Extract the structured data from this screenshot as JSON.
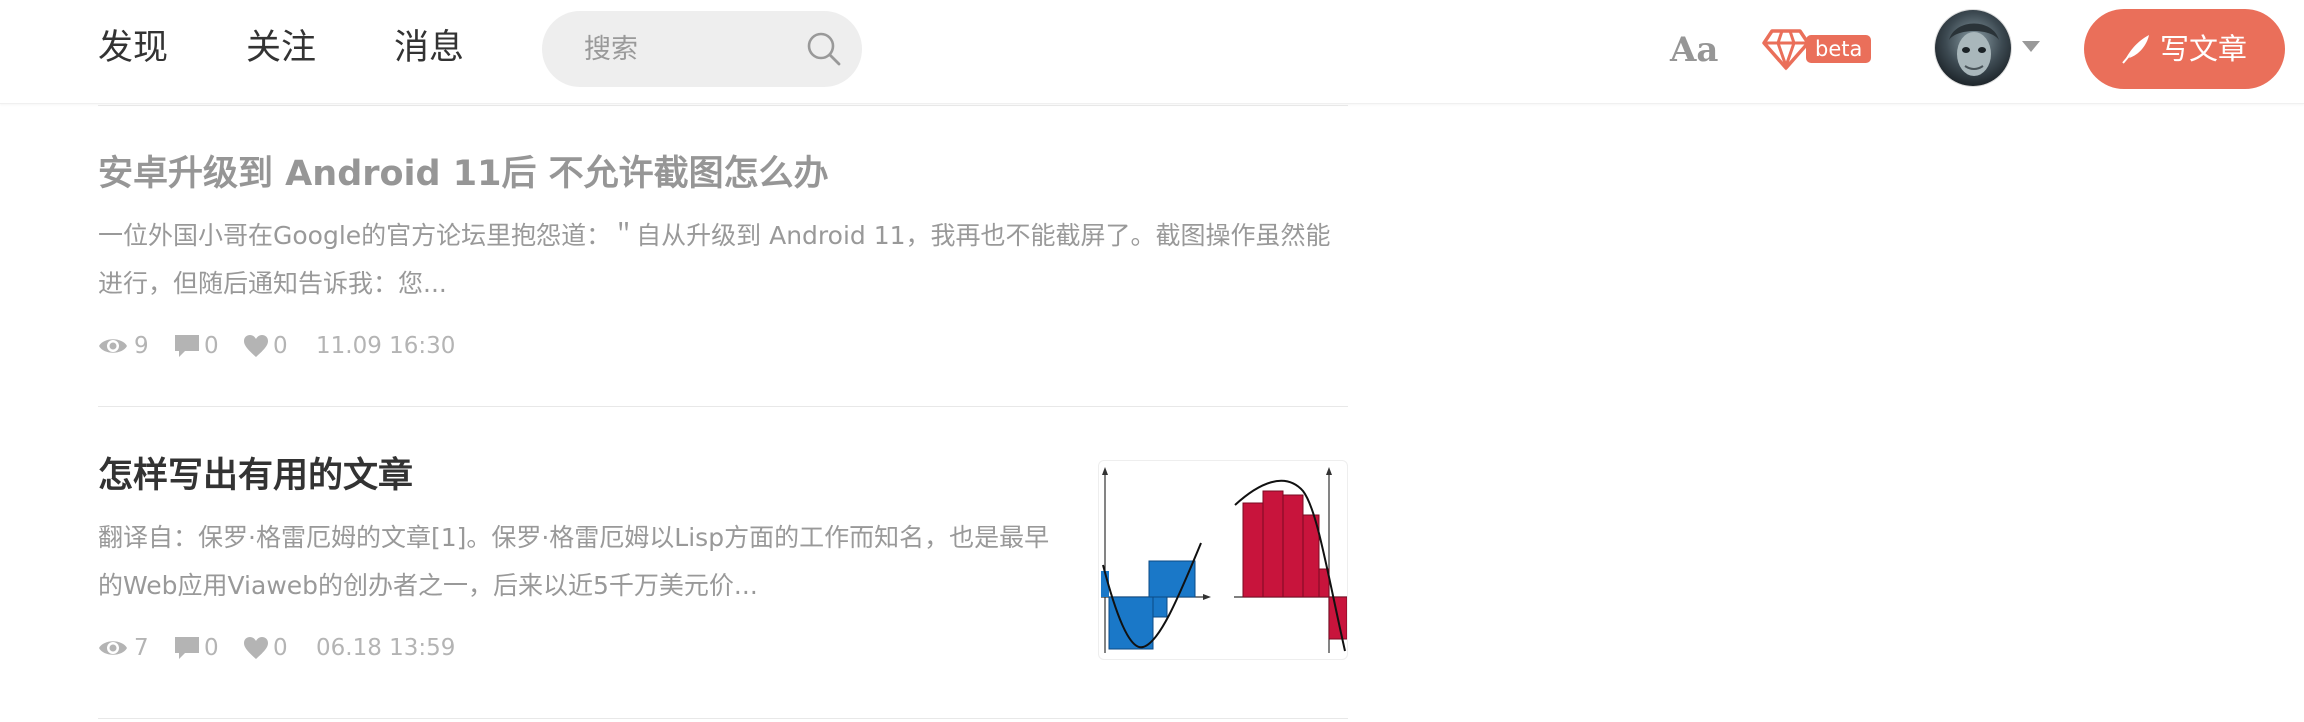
{
  "nav": {
    "items": [
      {
        "label": "发现"
      },
      {
        "label": "关注"
      },
      {
        "label": "消息"
      }
    ],
    "search_placeholder": "搜索",
    "font_toggle": "Aa",
    "beta_label": "beta",
    "write_label": "写文章"
  },
  "colors": {
    "accent": "#ea6f5a",
    "read_title": "#969696",
    "title": "#333333",
    "meta": "#b4b4b4"
  },
  "icons": [
    "search-icon",
    "diamond-icon",
    "caret-down-icon",
    "feather-pen-icon",
    "eye-icon",
    "comment-icon",
    "heart-icon"
  ],
  "articles": [
    {
      "title": "安卓升级到 Android 11后 不允许截图怎么办",
      "abstract": "一位外国小哥在Google的官方论坛里抱怨道：＂自从升级到 Android 11，我再也不能截屏了。截图操作虽然能进行，但随后通知告诉我：您...",
      "views": "9",
      "comments": "0",
      "likes": "0",
      "time": "11.09 16:30"
    },
    {
      "title": "怎样写出有用的文章",
      "abstract": "翻译自：保罗·格雷厄姆的文章[1]。保罗·格雷厄姆以Lisp方面的工作而知名，也是最早的Web应用Viaweb的创办者之一，后来以近5千万美元价...",
      "views": "7",
      "comments": "0",
      "likes": "0",
      "time": "06.18 13:59"
    }
  ]
}
